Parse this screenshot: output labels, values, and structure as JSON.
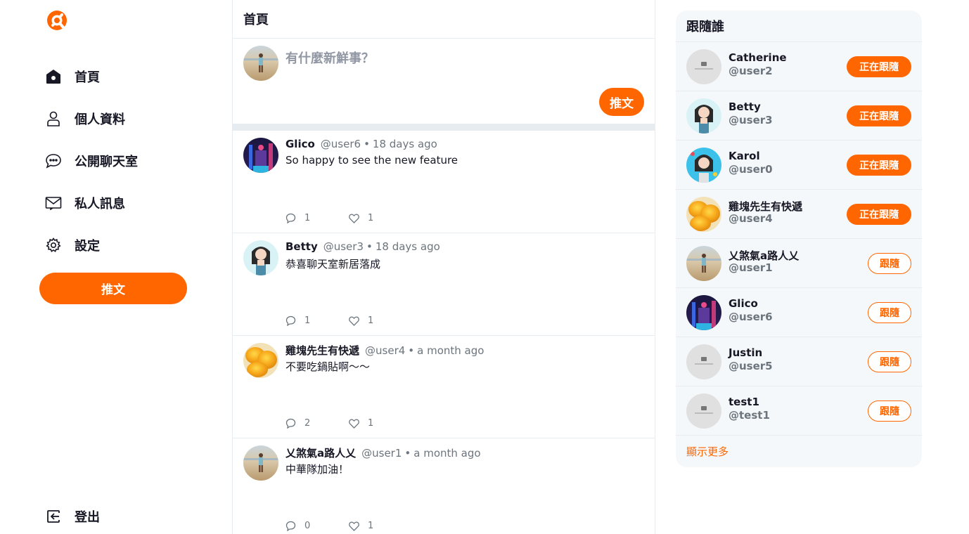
{
  "brand": {
    "accent": "#FF6600"
  },
  "nav": {
    "items": [
      {
        "label": "首頁",
        "icon": "home-icon"
      },
      {
        "label": "個人資料",
        "icon": "user-icon"
      },
      {
        "label": "公開聊天室",
        "icon": "chat-icon"
      },
      {
        "label": "私人訊息",
        "icon": "mail-icon"
      },
      {
        "label": "設定",
        "icon": "gear-icon"
      }
    ],
    "tweet_button": "推文",
    "logout": "登出"
  },
  "main": {
    "title": "首頁",
    "composer": {
      "placeholder": "有什麼新鮮事？",
      "button": "推文"
    },
    "tweets": [
      {
        "name": "Glico",
        "handle": "@user6",
        "time": "18 days ago",
        "body": "So happy to see the new feature",
        "replies": "1",
        "likes": "1"
      },
      {
        "name": "Betty",
        "handle": "@user3",
        "time": "18 days ago",
        "body": "恭喜聊天室新居落成",
        "replies": "1",
        "likes": "1"
      },
      {
        "name": "雞塊先生有快遞",
        "handle": "@user4",
        "time": "a month ago",
        "body": "不要吃鍋貼啊～～",
        "replies": "2",
        "likes": "1"
      },
      {
        "name": "乂煞氣a路人乂",
        "handle": "@user1",
        "time": "a month ago",
        "body": "中華隊加油！",
        "replies": "0",
        "likes": "1"
      }
    ]
  },
  "follow": {
    "title": "跟隨誰",
    "users": [
      {
        "name": "Catherine",
        "handle": "@user2",
        "button": "正在跟隨"
      },
      {
        "name": "Betty",
        "handle": "@user3",
        "button": "正在跟隨"
      },
      {
        "name": "Karol",
        "handle": "@user0",
        "button": "正在跟隨"
      },
      {
        "name": "雞塊先生有快遞",
        "handle": "@user4",
        "button": "正在跟隨"
      },
      {
        "name": "乂煞氣a路人乂",
        "handle": "@user1",
        "button": "跟隨"
      },
      {
        "name": "Glico",
        "handle": "@user6",
        "button": "跟隨"
      },
      {
        "name": "Justin",
        "handle": "@user5",
        "button": "跟隨"
      },
      {
        "name": "test1",
        "handle": "@test1",
        "button": "跟隨"
      }
    ],
    "show_more": "顯示更多"
  }
}
